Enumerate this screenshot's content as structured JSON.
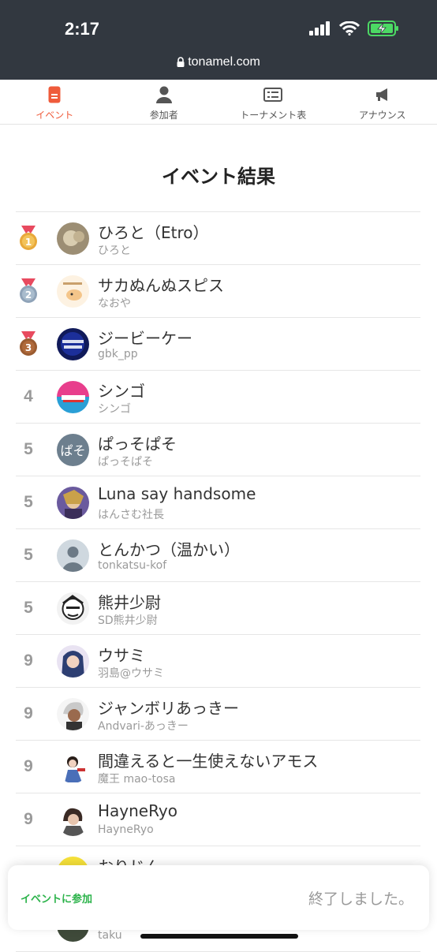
{
  "status": {
    "time": "2:17",
    "url": "tonamel.com"
  },
  "tabs": [
    {
      "label": "イベント",
      "icon": "event-icon"
    },
    {
      "label": "参加者",
      "icon": "person-icon"
    },
    {
      "label": "トーナメント表",
      "icon": "bracket-icon"
    },
    {
      "label": "アナウンス",
      "icon": "megaphone-icon"
    }
  ],
  "colors": {
    "accent": "#ef5b3b",
    "join": "#2bb34a",
    "gold": "#e8a93a",
    "silver": "#8fa3b8",
    "bronze": "#b06a3b"
  },
  "page_title": "イベント結果",
  "results": [
    {
      "rank": "1",
      "medal": "gold",
      "name": "ひろと（Etro）",
      "sub": "ひろと"
    },
    {
      "rank": "2",
      "medal": "silver",
      "name": "サカぬんぬスピス",
      "sub": "なおや"
    },
    {
      "rank": "3",
      "medal": "bronze",
      "name": "ジービーケー",
      "sub": "gbk_pp"
    },
    {
      "rank": "4",
      "name": "シンゴ",
      "sub": "シンゴ"
    },
    {
      "rank": "5",
      "name": "ぱっそぱそ",
      "sub": "ぱっそぱそ"
    },
    {
      "rank": "5",
      "name": "Luna say handsome",
      "sub": "はんさむ社長"
    },
    {
      "rank": "5",
      "name": "とんかつ（温かい）",
      "sub": "tonkatsu-kof"
    },
    {
      "rank": "5",
      "name": "熊井少尉",
      "sub": "SD熊井少尉"
    },
    {
      "rank": "9",
      "name": "ウサミ",
      "sub": "羽島@ウサミ"
    },
    {
      "rank": "9",
      "name": "ジャンボリあっきー",
      "sub": "Andvari-あっきー"
    },
    {
      "rank": "9",
      "name": "間違えると一生使えないアモス",
      "sub": "魔王 mao-tosa"
    },
    {
      "rank": "9",
      "name": "HayneRyo",
      "sub": "HayneRyo"
    },
    {
      "rank": "",
      "name": "おりじん",
      "sub": ""
    },
    {
      "rank": "",
      "name": "",
      "sub": "taku"
    }
  ],
  "bottom": {
    "join_label": "イベントに参加",
    "status_label": "終了しました。"
  }
}
